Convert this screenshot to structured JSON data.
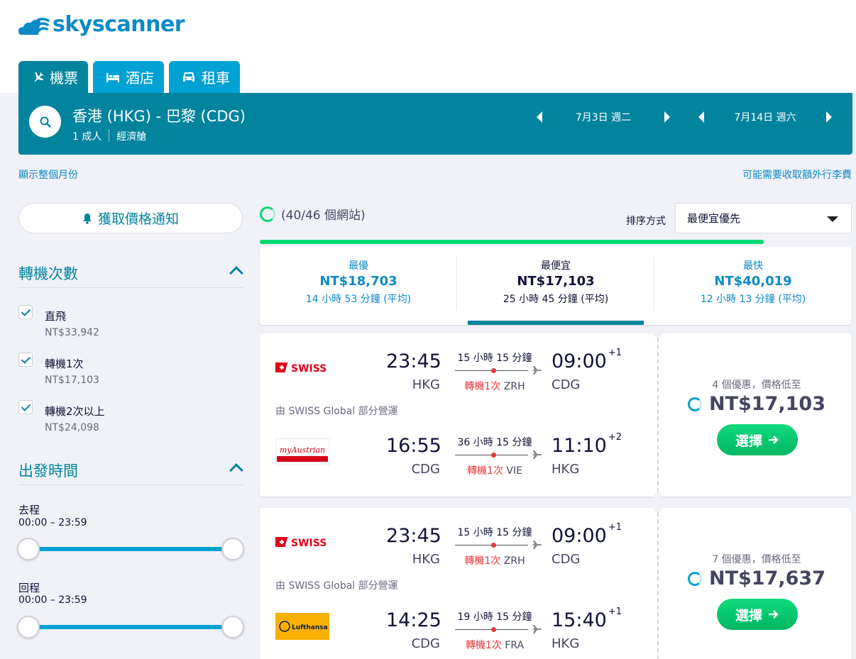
{
  "brand": {
    "name": "skyscanner",
    "color": "#0b8ac6"
  },
  "tabs": [
    {
      "label": "機票",
      "icon": "plane-icon",
      "active": true
    },
    {
      "label": "酒店",
      "icon": "bed-icon",
      "active": false
    },
    {
      "label": "租車",
      "icon": "car-icon",
      "active": false
    }
  ],
  "search": {
    "route": "香港 (HKG) - 巴黎 (CDG)",
    "passengers": "1 成人",
    "cabin": "經濟艙",
    "depart_date": "7月3日 週二",
    "return_date": "7月14日 週六"
  },
  "links": {
    "show_month": "顯示整個月份",
    "baggage_fee": "可能需要收取額外行李費"
  },
  "sidebar": {
    "alert_button": "獲取價格通知",
    "stops_title": "轉機次數",
    "stops": [
      {
        "label": "直飛",
        "price": "NT$33,942",
        "checked": true
      },
      {
        "label": "轉機1次",
        "price": "NT$17,103",
        "checked": true
      },
      {
        "label": "轉機2次以上",
        "price": "NT$24,098",
        "checked": true
      }
    ],
    "times_title": "出發時間",
    "outbound_label": "去程",
    "outbound_range": "00:00 – 23:59",
    "return_label": "回程",
    "return_range": "00:00 – 23:59"
  },
  "results": {
    "progress": "(40/46 個網站)",
    "progress_fraction": 0.87,
    "sort_label": "排序方式",
    "sort_value": "最便宜優先"
  },
  "summary": [
    {
      "title": "最優",
      "price": "NT$18,703",
      "duration": "14 小時 53 分鐘 (平均)",
      "color": "#0b8ac6",
      "selected": false
    },
    {
      "title": "最便宜",
      "price": "NT$17,103",
      "duration": "25 小時 45 分鐘 (平均)",
      "color": "#111236",
      "selected": true
    },
    {
      "title": "最快",
      "price": "NT$40,019",
      "duration": "12 小時 13 分鐘 (平均)",
      "color": "#0b8ac6",
      "selected": false
    }
  ],
  "cards": [
    {
      "outbound": {
        "airline": "SWISS",
        "dep_time": "23:45",
        "dep_code": "HKG",
        "duration": "15 小時 15 分鐘",
        "stops": "轉機1次",
        "via": "ZRH",
        "arr_time": "09:00",
        "arr_offset": "+1",
        "arr_code": "CDG"
      },
      "operated_by": "由 SWISS Global 部分營運",
      "inbound": {
        "airline": "myAustrian",
        "dep_time": "16:55",
        "dep_code": "CDG",
        "duration": "36 小時 15 分鐘",
        "stops": "轉機1次",
        "via": "VIE",
        "arr_time": "11:10",
        "arr_offset": "+2",
        "arr_code": "HKG"
      },
      "deals": "4 個優惠，價格低至",
      "price": "NT$17,103",
      "button": "選擇"
    },
    {
      "outbound": {
        "airline": "SWISS",
        "dep_time": "23:45",
        "dep_code": "HKG",
        "duration": "15 小時 15 分鐘",
        "stops": "轉機1次",
        "via": "ZRH",
        "arr_time": "09:00",
        "arr_offset": "+1",
        "arr_code": "CDG"
      },
      "operated_by": "由 SWISS Global 部分營運",
      "inbound": {
        "airline": "Lufthansa",
        "dep_time": "14:25",
        "dep_code": "CDG",
        "duration": "19 小時 15 分鐘",
        "stops": "轉機1次",
        "via": "FRA",
        "arr_time": "15:40",
        "arr_offset": "+1",
        "arr_code": "HKG"
      },
      "deals": "7 個優惠，價格低至",
      "price": "NT$17,637",
      "button": "選擇"
    }
  ]
}
